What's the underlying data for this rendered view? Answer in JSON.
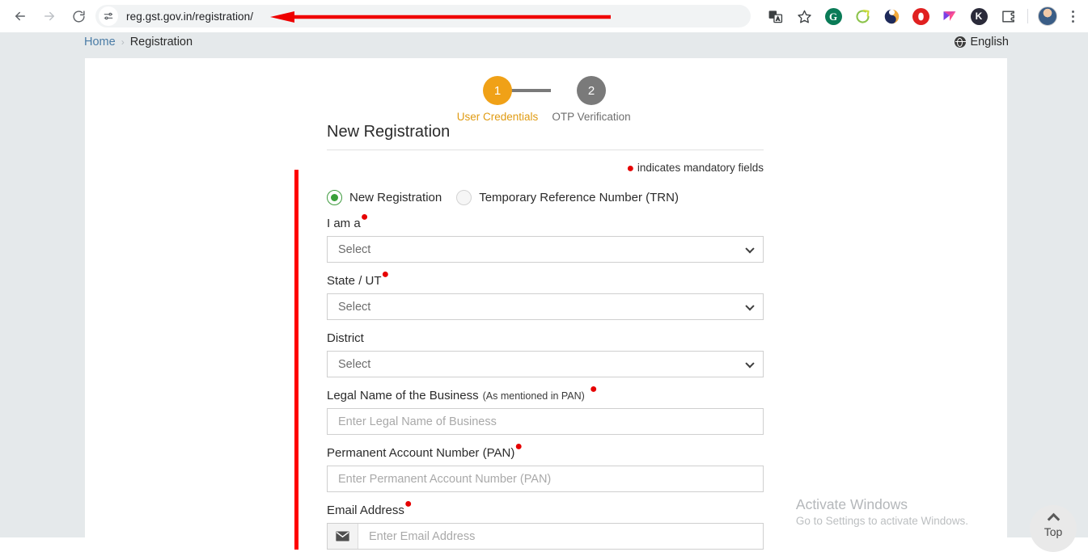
{
  "browser": {
    "back_tooltip": "Back",
    "forward_tooltip": "Forward",
    "reload_tooltip": "Reload",
    "site_info_tooltip": "View site information",
    "url": "reg.gst.gov.in/registration/",
    "actions": {
      "translate": "translate-icon",
      "bookmark": "star-icon",
      "extensions": [
        {
          "name": "grammarly-extension-icon",
          "glyph": "G"
        },
        {
          "name": "simplify-extension-icon",
          "glyph": "↗"
        },
        {
          "name": "honey-extension-icon",
          "glyph": ""
        },
        {
          "name": "opera-extension-icon",
          "glyph": ""
        },
        {
          "name": "flowcv-extension-icon",
          "glyph": ""
        },
        {
          "name": "kite-extension-icon",
          "glyph": "K"
        },
        {
          "name": "extensions-puzzle-icon",
          "glyph": ""
        }
      ],
      "profile": "profile-avatar",
      "menu": "chrome-menu-icon"
    }
  },
  "breadcrumb": {
    "home": "Home",
    "separator": "›",
    "current": "Registration"
  },
  "language": {
    "label": "English",
    "icon": "globe-icon"
  },
  "stepper": {
    "steps": [
      {
        "number": "1",
        "label": "User Credentials",
        "state": "active",
        "color": "#f0a117"
      },
      {
        "number": "2",
        "label": "OTP Verification",
        "state": "inactive",
        "color": "#7a7a7a"
      }
    ]
  },
  "form": {
    "title": "New Registration",
    "mandatory_note": "indicates mandatory fields",
    "mandatory_marker": "●",
    "registration_type": {
      "options": [
        {
          "label": "New Registration",
          "selected": true
        },
        {
          "label": "Temporary Reference Number (TRN)",
          "selected": false
        }
      ]
    },
    "fields": [
      {
        "id": "i-am-a",
        "label": "I am a",
        "required": true,
        "control": "select",
        "value": "Select"
      },
      {
        "id": "state-ut",
        "label": "State / UT",
        "required": true,
        "control": "select",
        "value": "Select"
      },
      {
        "id": "district",
        "label": "District",
        "required": false,
        "control": "select",
        "value": "Select"
      },
      {
        "id": "legal-name",
        "label": "Legal Name of the Business",
        "hint": "(As mentioned in PAN)",
        "required": true,
        "control": "text",
        "placeholder": "Enter Legal Name of Business"
      },
      {
        "id": "pan",
        "label": "Permanent Account Number (PAN)",
        "required": true,
        "control": "text",
        "placeholder": "Enter Permanent Account Number (PAN)"
      },
      {
        "id": "email",
        "label": "Email Address",
        "required": true,
        "control": "text-with-icon",
        "icon": "envelope-icon",
        "placeholder": "Enter Email Address"
      }
    ]
  },
  "scroll_top_button": {
    "label": "Top",
    "icon": "chevron-up-icon"
  },
  "watermark": {
    "title": "Activate Windows",
    "subtitle": "Go to Settings to activate Windows."
  },
  "annotations": {
    "arrow_color": "#f00000",
    "bar_color": "#ff0000"
  }
}
